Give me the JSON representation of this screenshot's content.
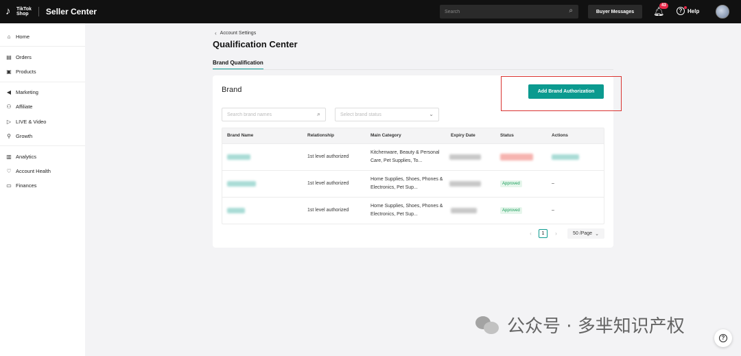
{
  "header": {
    "logo_text_line1": "TikTok",
    "logo_text_line2": "Shop",
    "app_title": "Seller Center",
    "search_placeholder": "Search",
    "buyer_messages_label": "Buyer Messages",
    "notification_count": "43",
    "help_label": "Help"
  },
  "sidebar": {
    "items": [
      {
        "label": "Home",
        "icon": "home-icon"
      },
      {
        "label": "Orders",
        "icon": "orders-icon"
      },
      {
        "label": "Products",
        "icon": "products-icon"
      },
      {
        "label": "Marketing",
        "icon": "marketing-icon"
      },
      {
        "label": "Affiliate",
        "icon": "affiliate-icon"
      },
      {
        "label": "LIVE & Video",
        "icon": "live-video-icon"
      },
      {
        "label": "Growth",
        "icon": "growth-icon"
      },
      {
        "label": "Analytics",
        "icon": "analytics-icon"
      },
      {
        "label": "Account Health",
        "icon": "account-health-icon"
      },
      {
        "label": "Finances",
        "icon": "finances-icon"
      }
    ]
  },
  "main": {
    "breadcrumb": "Account Settings",
    "page_title": "Qualification Center",
    "tab": "Brand Qualification",
    "card_title": "Brand",
    "add_button": "Add Brand Authorization",
    "search_brand_placeholder": "Search brand names",
    "status_select_placeholder": "Select brand status",
    "table": {
      "headers": [
        "Brand Name",
        "Relationship",
        "Main Category",
        "Expiry Date",
        "Status",
        "Actions"
      ],
      "rows": [
        {
          "relationship": "1st level authorized",
          "category": "Kitchenware, Beauty & Personal Care, Pet Supplies, To...",
          "status": "",
          "action": ""
        },
        {
          "relationship": "1st level authorized",
          "category": "Home Supplies, Shoes, Phones & Electronics, Pet Sup...",
          "status": "Approved",
          "action": "–"
        },
        {
          "relationship": "1st level authorized",
          "category": "Home Supplies, Shoes, Phones & Electronics, Pet Sup...",
          "status": "Approved",
          "action": "–"
        }
      ]
    },
    "pagination": {
      "current_page": "1",
      "page_size": "50 /Page"
    }
  },
  "watermark": "公众号 · 多芈知识产权",
  "colors": {
    "accent": "#0b9a8f",
    "topbar": "#111111",
    "highlight_box": "#d9322f",
    "approved_text": "#1a9e5a"
  }
}
